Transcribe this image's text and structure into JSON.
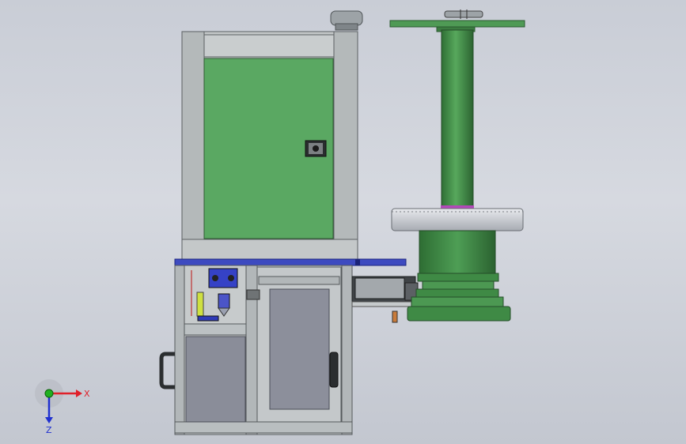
{
  "triad": {
    "x_label": "X",
    "z_label": "Z"
  },
  "colors": {
    "background_top": "#c9cdd6",
    "cabinet_green": "#5aa862",
    "frame_grey": "#b8bcbc",
    "column_green": "#3f8a45",
    "plate_blue": "#3d4ac0",
    "axis_red": "#e0202a",
    "axis_green": "#20b020",
    "axis_blue": "#2030d0"
  }
}
